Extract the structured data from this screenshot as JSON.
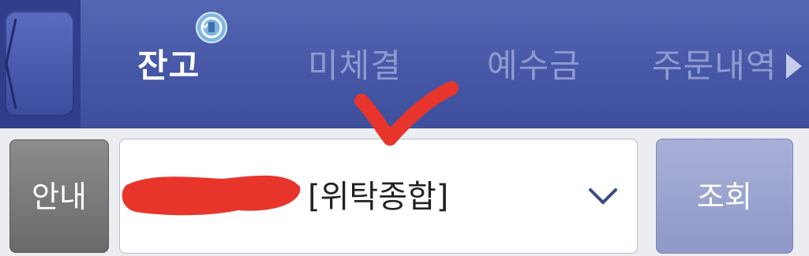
{
  "header": {
    "tabs": [
      {
        "label": "잔고",
        "active": true
      },
      {
        "label": "미체결",
        "active": false
      },
      {
        "label": "예수금",
        "active": false
      },
      {
        "label": "주문내역",
        "active": false
      }
    ]
  },
  "icons": {
    "back": "back-arrow-icon",
    "refresh": "refresh-icon",
    "next": "next-tab-arrow-icon",
    "dropdown": "chevron-down-icon"
  },
  "controls": {
    "info_label": "안내",
    "account_suffix": "[위탁종합]",
    "search_label": "조회"
  },
  "colors": {
    "header_bg": "#4557a6",
    "active_tab": "#ffffff",
    "inactive_tab": "#8f9ad0",
    "annotation_red": "#e8352c",
    "search_button": "#9aa2d0",
    "info_button": "#7a7a7a"
  }
}
